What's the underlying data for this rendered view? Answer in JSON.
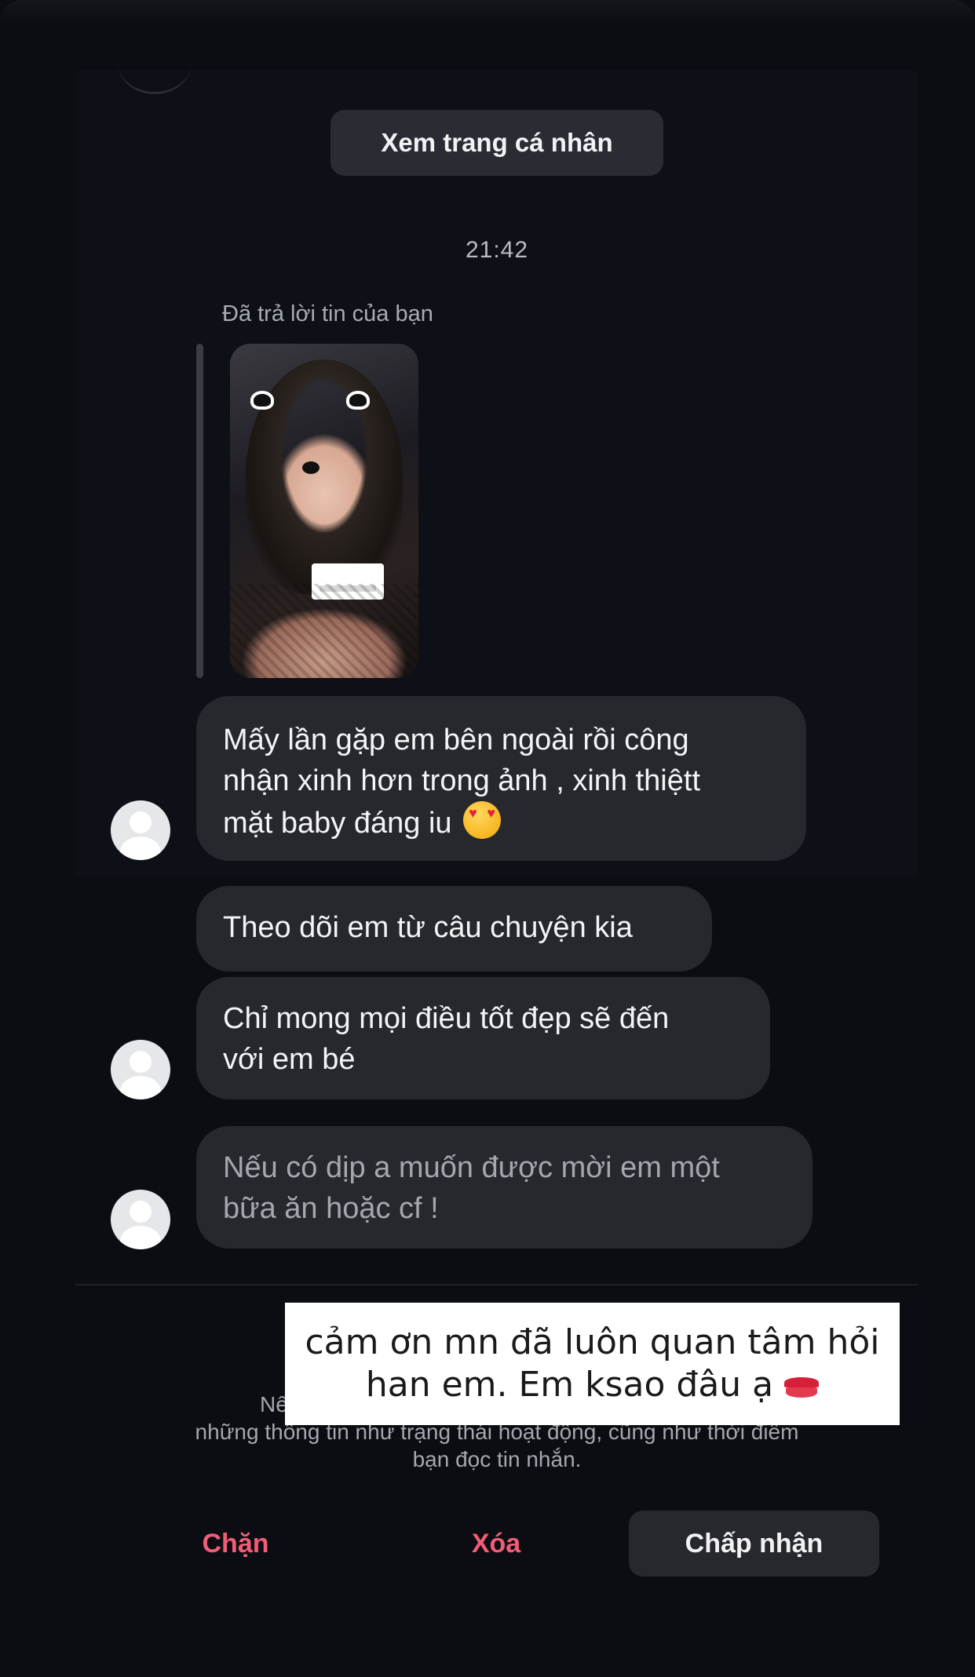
{
  "header": {
    "view_profile_label": "Xem trang cá nhân",
    "timestamp": "21:42"
  },
  "story_reply": {
    "label": "Đã trả lời tin của bạn"
  },
  "messages": [
    {
      "lines": [
        "Mấy lần gặp em bên ngoài rồi công",
        "nhận xinh hơn trong ảnh , xinh thiệtt",
        "mặt baby đáng iu"
      ],
      "emoji": "heart-eyes-emoji"
    },
    {
      "lines": [
        "Theo dõi em từ câu chuyện kia"
      ]
    },
    {
      "lines": [
        "Chỉ mong mọi điều tốt đẹp sẽ đến",
        "với em bé"
      ]
    },
    {
      "lines": [
        "Nếu có dịp a muốn được mời em một",
        "bữa ăn hoặc cf !"
      ]
    }
  ],
  "request": {
    "title": "Chấp nhận",
    "description_lines": [
      "Nếu bạn chấp nhận, họ cũng sẽ có thể nhìn thấy",
      "những thông tin như trạng thái hoạt động, cũng như thời điểm",
      "bạn đọc tin nhắn."
    ],
    "block_label": "Chặn",
    "delete_label": "Xóa",
    "accept_label": "Chấp nhận"
  },
  "overlay_caption": {
    "lines": [
      "cảm ơn mn đã luôn quan tâm hỏi",
      "han em. Em ksao đâu ạ"
    ],
    "emoji": "kiss-mark-emoji"
  },
  "colors": {
    "background": "#0b0d12",
    "bubble": "#26282e",
    "danger": "#f25c78",
    "caption_bg": "#ffffff"
  }
}
